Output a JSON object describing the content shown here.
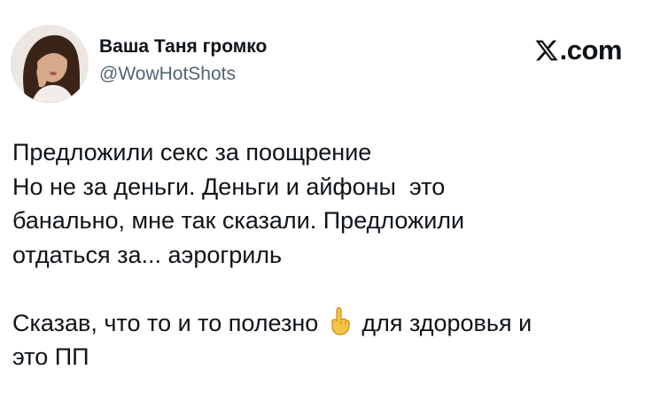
{
  "post": {
    "author": {
      "display_name": "Ваша Таня громко",
      "handle": "@WowHotShots",
      "avatar_icon": "profile-photo-avatar"
    },
    "brand": {
      "icon": "x-logo-icon",
      "text": ".com"
    },
    "text": {
      "line1": "Предложили секс за поощрение",
      "line2": "Но не за деньги. Деньги и айфоны  это",
      "line3": "банально, мне так сказали. Предложили",
      "line4": "отдаться за... аэрогриль",
      "line5_before": "Сказав, что то и то полезно",
      "line5_emoji": "point-up-emoji",
      "line5_after": "для здоровья и",
      "line6": "это ПП"
    }
  },
  "colors": {
    "background": "#ffffff",
    "text_primary": "#0f1419",
    "text_secondary": "#536471",
    "emoji_skin": "#f6c445"
  }
}
